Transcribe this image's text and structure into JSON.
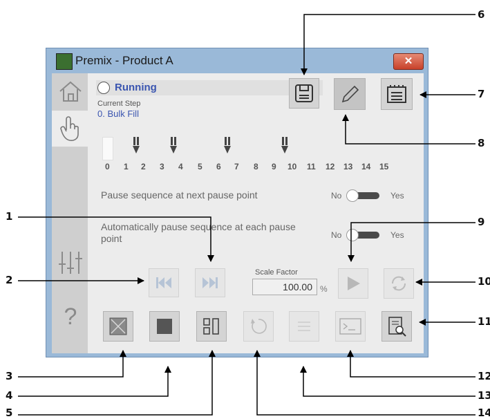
{
  "window": {
    "title": "Premix - Product A",
    "close_icon": "close-icon"
  },
  "status": {
    "state": "Running",
    "current_step_label": "Current Step",
    "current_step": "0. Bulk Fill"
  },
  "step_numbers": [
    "0",
    "1",
    "2",
    "3",
    "4",
    "5",
    "6",
    "7",
    "8",
    "9",
    "10",
    "11",
    "12",
    "13",
    "14",
    "15"
  ],
  "pause_next": {
    "label": "Pause sequence at next pause point",
    "no": "No",
    "yes": "Yes",
    "value": "No"
  },
  "pause_each": {
    "label": "Automatically pause sequence at each pause point",
    "no": "No",
    "yes": "Yes",
    "value": "No"
  },
  "scale": {
    "label": "Scale Factor",
    "value": "100.00",
    "unit": "%"
  },
  "callouts": [
    "1",
    "2",
    "3",
    "4",
    "5",
    "6",
    "7",
    "8",
    "9",
    "10",
    "11",
    "12",
    "13",
    "14"
  ],
  "colors": {
    "accent": "#3a55b0",
    "window_frame": "#9ab9d8",
    "arrow": "#000000"
  }
}
